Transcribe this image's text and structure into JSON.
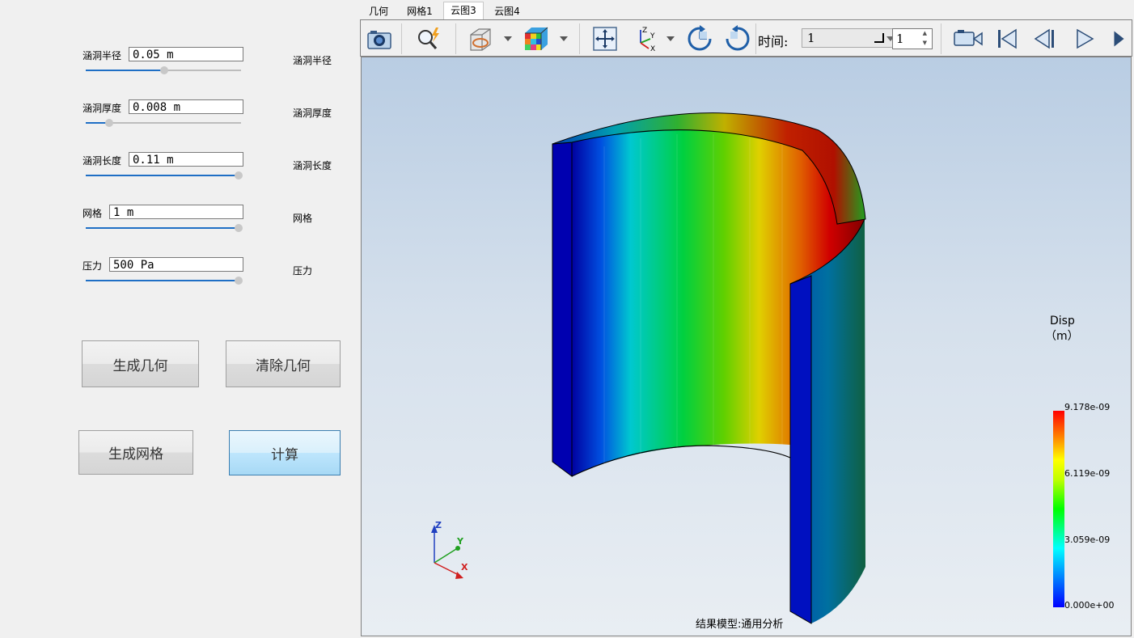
{
  "params": [
    {
      "label": "涵洞半径",
      "value": "0.05 m",
      "right_label": "涵洞半径",
      "slider_level": 0.5
    },
    {
      "label": "涵洞厚度",
      "value": "0.008 m",
      "right_label": "涵洞厚度",
      "slider_level": 0.15
    },
    {
      "label": "涵洞长度",
      "value": "0.11 m",
      "right_label": "涵洞长度",
      "slider_level": 1.0
    },
    {
      "label": "网格",
      "value": "1 m",
      "right_label": "网格",
      "slider_level": 1.0
    },
    {
      "label": "压力",
      "value": "500 Pa",
      "right_label": "压力",
      "slider_level": 1.0
    }
  ],
  "buttons": {
    "generate_geometry": "生成几何",
    "clear_geometry": "清除几何",
    "generate_mesh": "生成网格",
    "compute": "计算"
  },
  "tabs": [
    "几何",
    "网格1",
    "云图3",
    "云图4"
  ],
  "active_tab": "云图3",
  "toolbar": {
    "time_label": "时间:",
    "time_value": "1",
    "step_value": "1",
    "icons": [
      "camera-icon",
      "zoom-icon",
      "clip-box-icon",
      "mesh-cube-icon",
      "fit-view-icon",
      "axes-icon",
      "rotate-cw-icon",
      "rotate-ccw-icon",
      "record-icon",
      "first-frame-icon",
      "prev-frame-icon",
      "play-icon",
      "last-frame-icon"
    ]
  },
  "legend": {
    "title": "Disp",
    "unit": "（m）",
    "ticks": [
      "9.178e-09",
      "6.119e-09",
      "3.059e-09",
      "0.000e+00"
    ]
  },
  "axes": {
    "z": "Z",
    "y": "Y",
    "x": "X"
  },
  "model_label": "结果模型:通用分析",
  "colors": {
    "accent": "#1f6fc5",
    "scale_max": "#ff0000",
    "scale_min": "#0000ff"
  }
}
